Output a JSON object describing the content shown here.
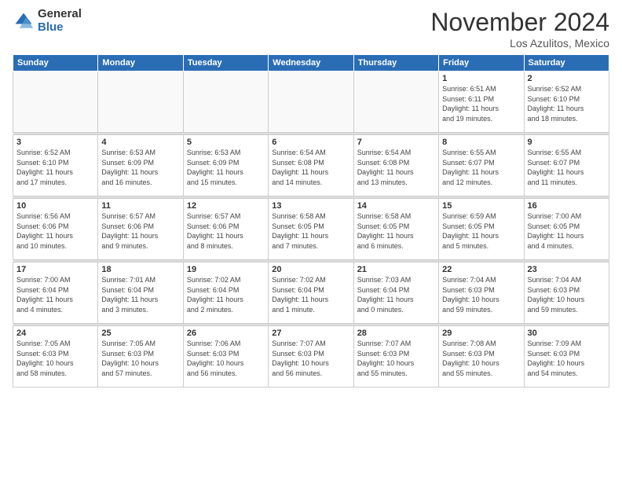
{
  "logo": {
    "general": "General",
    "blue": "Blue"
  },
  "header": {
    "month": "November 2024",
    "location": "Los Azulitos, Mexico"
  },
  "weekdays": [
    "Sunday",
    "Monday",
    "Tuesday",
    "Wednesday",
    "Thursday",
    "Friday",
    "Saturday"
  ],
  "weeks": [
    [
      {
        "day": "",
        "info": ""
      },
      {
        "day": "",
        "info": ""
      },
      {
        "day": "",
        "info": ""
      },
      {
        "day": "",
        "info": ""
      },
      {
        "day": "",
        "info": ""
      },
      {
        "day": "1",
        "info": "Sunrise: 6:51 AM\nSunset: 6:11 PM\nDaylight: 11 hours\nand 19 minutes."
      },
      {
        "day": "2",
        "info": "Sunrise: 6:52 AM\nSunset: 6:10 PM\nDaylight: 11 hours\nand 18 minutes."
      }
    ],
    [
      {
        "day": "3",
        "info": "Sunrise: 6:52 AM\nSunset: 6:10 PM\nDaylight: 11 hours\nand 17 minutes."
      },
      {
        "day": "4",
        "info": "Sunrise: 6:53 AM\nSunset: 6:09 PM\nDaylight: 11 hours\nand 16 minutes."
      },
      {
        "day": "5",
        "info": "Sunrise: 6:53 AM\nSunset: 6:09 PM\nDaylight: 11 hours\nand 15 minutes."
      },
      {
        "day": "6",
        "info": "Sunrise: 6:54 AM\nSunset: 6:08 PM\nDaylight: 11 hours\nand 14 minutes."
      },
      {
        "day": "7",
        "info": "Sunrise: 6:54 AM\nSunset: 6:08 PM\nDaylight: 11 hours\nand 13 minutes."
      },
      {
        "day": "8",
        "info": "Sunrise: 6:55 AM\nSunset: 6:07 PM\nDaylight: 11 hours\nand 12 minutes."
      },
      {
        "day": "9",
        "info": "Sunrise: 6:55 AM\nSunset: 6:07 PM\nDaylight: 11 hours\nand 11 minutes."
      }
    ],
    [
      {
        "day": "10",
        "info": "Sunrise: 6:56 AM\nSunset: 6:06 PM\nDaylight: 11 hours\nand 10 minutes."
      },
      {
        "day": "11",
        "info": "Sunrise: 6:57 AM\nSunset: 6:06 PM\nDaylight: 11 hours\nand 9 minutes."
      },
      {
        "day": "12",
        "info": "Sunrise: 6:57 AM\nSunset: 6:06 PM\nDaylight: 11 hours\nand 8 minutes."
      },
      {
        "day": "13",
        "info": "Sunrise: 6:58 AM\nSunset: 6:05 PM\nDaylight: 11 hours\nand 7 minutes."
      },
      {
        "day": "14",
        "info": "Sunrise: 6:58 AM\nSunset: 6:05 PM\nDaylight: 11 hours\nand 6 minutes."
      },
      {
        "day": "15",
        "info": "Sunrise: 6:59 AM\nSunset: 6:05 PM\nDaylight: 11 hours\nand 5 minutes."
      },
      {
        "day": "16",
        "info": "Sunrise: 7:00 AM\nSunset: 6:05 PM\nDaylight: 11 hours\nand 4 minutes."
      }
    ],
    [
      {
        "day": "17",
        "info": "Sunrise: 7:00 AM\nSunset: 6:04 PM\nDaylight: 11 hours\nand 4 minutes."
      },
      {
        "day": "18",
        "info": "Sunrise: 7:01 AM\nSunset: 6:04 PM\nDaylight: 11 hours\nand 3 minutes."
      },
      {
        "day": "19",
        "info": "Sunrise: 7:02 AM\nSunset: 6:04 PM\nDaylight: 11 hours\nand 2 minutes."
      },
      {
        "day": "20",
        "info": "Sunrise: 7:02 AM\nSunset: 6:04 PM\nDaylight: 11 hours\nand 1 minute."
      },
      {
        "day": "21",
        "info": "Sunrise: 7:03 AM\nSunset: 6:04 PM\nDaylight: 11 hours\nand 0 minutes."
      },
      {
        "day": "22",
        "info": "Sunrise: 7:04 AM\nSunset: 6:03 PM\nDaylight: 10 hours\nand 59 minutes."
      },
      {
        "day": "23",
        "info": "Sunrise: 7:04 AM\nSunset: 6:03 PM\nDaylight: 10 hours\nand 59 minutes."
      }
    ],
    [
      {
        "day": "24",
        "info": "Sunrise: 7:05 AM\nSunset: 6:03 PM\nDaylight: 10 hours\nand 58 minutes."
      },
      {
        "day": "25",
        "info": "Sunrise: 7:05 AM\nSunset: 6:03 PM\nDaylight: 10 hours\nand 57 minutes."
      },
      {
        "day": "26",
        "info": "Sunrise: 7:06 AM\nSunset: 6:03 PM\nDaylight: 10 hours\nand 56 minutes."
      },
      {
        "day": "27",
        "info": "Sunrise: 7:07 AM\nSunset: 6:03 PM\nDaylight: 10 hours\nand 56 minutes."
      },
      {
        "day": "28",
        "info": "Sunrise: 7:07 AM\nSunset: 6:03 PM\nDaylight: 10 hours\nand 55 minutes."
      },
      {
        "day": "29",
        "info": "Sunrise: 7:08 AM\nSunset: 6:03 PM\nDaylight: 10 hours\nand 55 minutes."
      },
      {
        "day": "30",
        "info": "Sunrise: 7:09 AM\nSunset: 6:03 PM\nDaylight: 10 hours\nand 54 minutes."
      }
    ]
  ]
}
